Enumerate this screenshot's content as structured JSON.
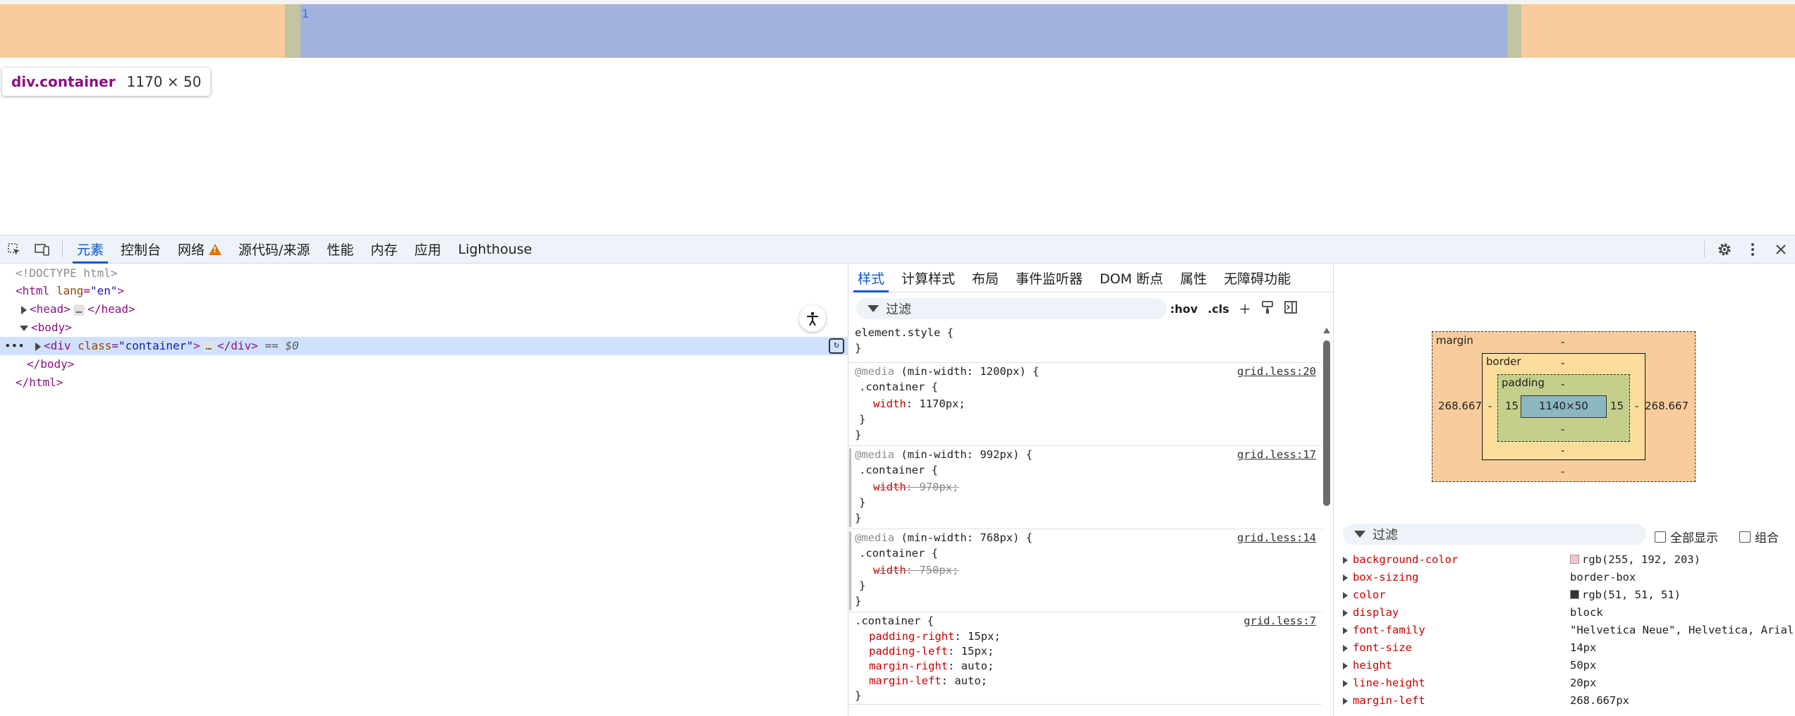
{
  "page": {
    "content_text": "1",
    "tooltip": {
      "tag": "div",
      "class": ".container",
      "dims": "1170 × 50"
    },
    "colors": {
      "margin": "#f8cc9d",
      "padding": "#c3c4a0",
      "content": "#a0b2dc"
    }
  },
  "toolbar": {
    "tabs": [
      "元素",
      "控制台",
      "网络",
      "源代码/来源",
      "性能",
      "内存",
      "应用",
      "Lighthouse"
    ],
    "active_tab": "元素",
    "icons": [
      "inspect-icon",
      "device-toggle-icon",
      "gear-icon",
      "more-vert-icon",
      "close-icon"
    ]
  },
  "elements": {
    "lines": [
      {
        "text": "<!DOCTYPE html>"
      },
      {
        "tag_open": "<html",
        "attr": "lang",
        "val": "\"en\"",
        "tag_close": ">"
      },
      {
        "tag_open": "<head>",
        "ellipsis": "…",
        "tag_close": "</head>"
      },
      {
        "tag_open": "<body>"
      },
      {
        "tag_open": "<div",
        "attr": "class",
        "val": "\"container\"",
        "tag_mid": ">",
        "ellipsis": "…",
        "tag_close": "</div>",
        "eq": "== $0"
      },
      {
        "tag_open": "</body>"
      },
      {
        "tag_open": "</html>"
      }
    ],
    "dots": "•••"
  },
  "styles": {
    "sub_tabs": [
      "样式",
      "计算样式",
      "布局",
      "事件监听器",
      "DOM 断点",
      "属性",
      "无障碍功能"
    ],
    "active_sub_tab": "样式",
    "filter_placeholder": "过滤",
    "hov": ":hov",
    "cls": ".cls",
    "rules": [
      {
        "selector": "element.style {",
        "close": "}"
      },
      {
        "media": "@media",
        "query": "(min-width: 1200px) {",
        "selector": ".container {",
        "props": [
          {
            "name": "width",
            "value": "1170px;",
            "struck": false
          }
        ],
        "close_inner": "}",
        "close": "}",
        "source": "grid.less:20"
      },
      {
        "media": "@media",
        "query": "(min-width: 992px) {",
        "selector": ".container {",
        "props": [
          {
            "name": "width",
            "value": "970px;",
            "struck": true
          }
        ],
        "close_inner": "}",
        "close": "}",
        "source": "grid.less:17"
      },
      {
        "media": "@media",
        "query": "(min-width: 768px) {",
        "selector": ".container {",
        "props": [
          {
            "name": "width",
            "value": "750px;",
            "struck": true
          }
        ],
        "close_inner": "}",
        "close": "}",
        "source": "grid.less:14"
      },
      {
        "selector": ".container {",
        "props": [
          {
            "name": "padding-right",
            "value": "15px;"
          },
          {
            "name": "padding-left",
            "value": "15px;"
          },
          {
            "name": "margin-right",
            "value": "auto;"
          },
          {
            "name": "margin-left",
            "value": "auto;"
          }
        ],
        "close": "}",
        "source": "grid.less:7"
      }
    ]
  },
  "box_model": {
    "margin_label": "margin",
    "border_label": "border",
    "padding_label": "padding",
    "margin_top": "-",
    "margin_bottom": "-",
    "margin_left": "268.667",
    "margin_right": "268.667",
    "border_top": "-",
    "border_bottom": "-",
    "border_left": "-",
    "border_right": "-",
    "padding_top": "-",
    "padding_bottom": "-",
    "padding_left": "15",
    "padding_right": "15",
    "content": "1140×50"
  },
  "computed": {
    "filter_placeholder": "过滤",
    "show_all": "全部显示",
    "group": "组合",
    "props": [
      {
        "name": "background-color",
        "value": "rgb(255, 192, 203)",
        "swatch": "#ffc0cb"
      },
      {
        "name": "box-sizing",
        "value": "border-box"
      },
      {
        "name": "color",
        "value": "rgb(51, 51, 51)",
        "swatch": "#333333"
      },
      {
        "name": "display",
        "value": "block"
      },
      {
        "name": "font-family",
        "value": "\"Helvetica Neue\", Helvetica, Arial,"
      },
      {
        "name": "font-size",
        "value": "14px"
      },
      {
        "name": "height",
        "value": "50px"
      },
      {
        "name": "line-height",
        "value": "20px"
      },
      {
        "name": "margin-left",
        "value": "268.667px"
      }
    ]
  }
}
